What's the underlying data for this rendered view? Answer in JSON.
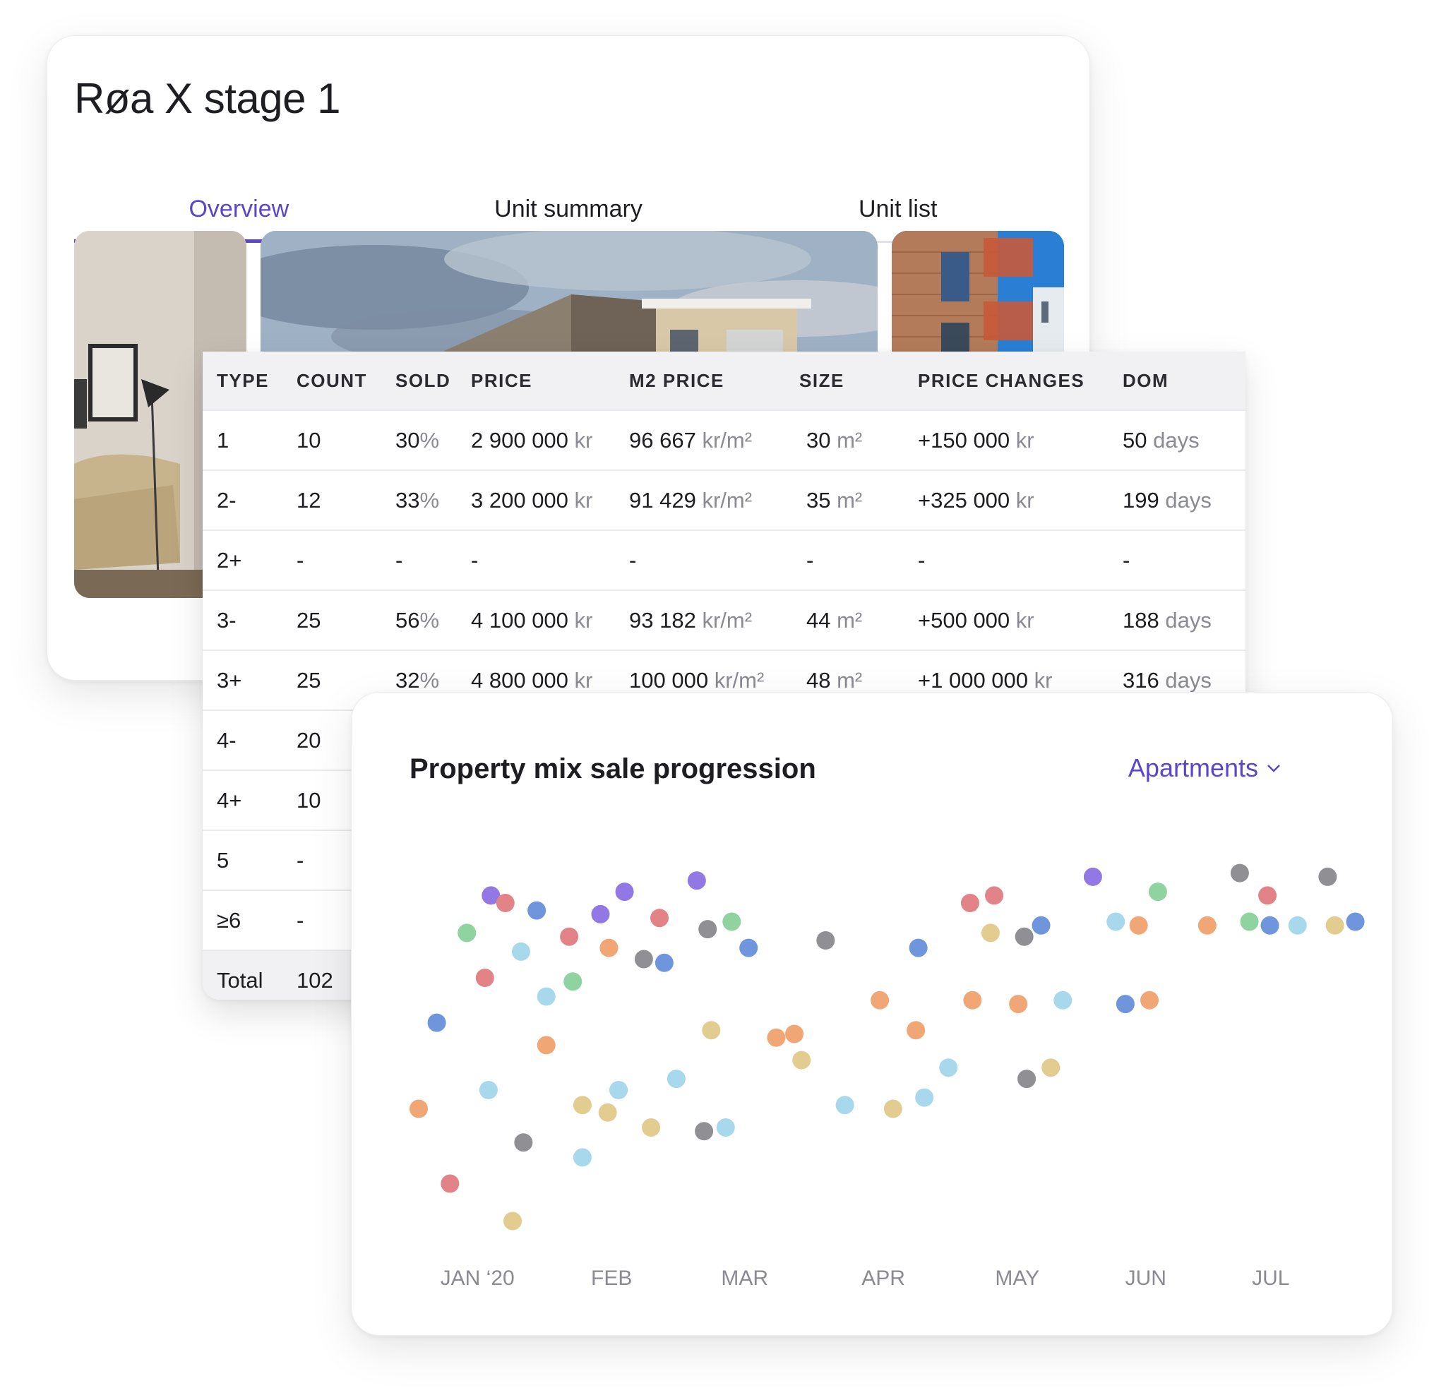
{
  "project": {
    "title": "Røa X stage 1",
    "tabs": [
      {
        "label": "Overview",
        "active": true
      },
      {
        "label": "Unit summary",
        "active": false
      },
      {
        "label": "Unit list",
        "active": false
      }
    ]
  },
  "table": {
    "headers": [
      "TYPE",
      "COUNT",
      "SOLD",
      "PRICE",
      "M2 PRICE",
      "SIZE",
      "PRICE CHANGES",
      "DOM"
    ],
    "rows": [
      {
        "type": "1",
        "count": "10",
        "sold": "30",
        "sold_unit": "%",
        "price": "2 900 000",
        "price_unit": "kr",
        "m2": "96 667",
        "m2_unit": "kr/m²",
        "size": "30",
        "size_unit": "m²",
        "change": "+150 000",
        "change_unit": "kr",
        "dom": "50",
        "dom_unit": "days"
      },
      {
        "type": "2-",
        "count": "12",
        "sold": "33",
        "sold_unit": "%",
        "price": "3 200 000",
        "price_unit": "kr",
        "m2": "91 429",
        "m2_unit": "kr/m²",
        "size": "35",
        "size_unit": "m²",
        "change": "+325 000",
        "change_unit": "kr",
        "dom": "199",
        "dom_unit": "days"
      },
      {
        "type": "2+",
        "count": "-",
        "sold": "-",
        "sold_unit": "",
        "price": "-",
        "price_unit": "",
        "m2": "-",
        "m2_unit": "",
        "size": "-",
        "size_unit": "",
        "change": "-",
        "change_unit": "",
        "dom": "-",
        "dom_unit": ""
      },
      {
        "type": "3-",
        "count": "25",
        "sold": "56",
        "sold_unit": "%",
        "price": "4 100 000",
        "price_unit": "kr",
        "m2": "93 182",
        "m2_unit": "kr/m²",
        "size": "44",
        "size_unit": "m²",
        "change": "+500 000",
        "change_unit": "kr",
        "dom": "188",
        "dom_unit": "days"
      },
      {
        "type": "3+",
        "count": "25",
        "sold": "32",
        "sold_unit": "%",
        "price": "4 800 000",
        "price_unit": "kr",
        "m2": "100 000",
        "m2_unit": "kr/m²",
        "size": "48",
        "size_unit": "m²",
        "change": "+1 000 000",
        "change_unit": "kr",
        "dom": "316",
        "dom_unit": "days"
      },
      {
        "type": "4-",
        "count": "20"
      },
      {
        "type": "4+",
        "count": "10"
      },
      {
        "type": "5",
        "count": "-"
      },
      {
        "type": "≥6",
        "count": "-"
      }
    ],
    "total": {
      "label": "Total",
      "count": "102"
    }
  },
  "chart": {
    "title": "Property mix sale progression",
    "filter": "Apartments",
    "colors": {
      "orange": "#f1a676",
      "red": "#e28387",
      "blue": "#6f95dd",
      "green": "#8fd3a0",
      "lightblue": "#a7d8ec",
      "purple": "#9278e4",
      "gray": "#8f8f94",
      "yellow": "#e3cc8f"
    }
  },
  "chart_data": {
    "type": "scatter",
    "x_ticks": [
      "JAN ‘20",
      "FEB",
      "MAR",
      "APR",
      "MAY",
      "JUN",
      "JUL"
    ],
    "x_domain": [
      0,
      7.3
    ],
    "y_domain": [
      0,
      100
    ],
    "points": [
      {
        "x": 0.0,
        "y": 35,
        "c": "orange"
      },
      {
        "x": 0.15,
        "y": 58,
        "c": "blue"
      },
      {
        "x": 0.26,
        "y": 15,
        "c": "red"
      },
      {
        "x": 0.4,
        "y": 82,
        "c": "green"
      },
      {
        "x": 0.55,
        "y": 70,
        "c": "red"
      },
      {
        "x": 0.6,
        "y": 92,
        "c": "purple"
      },
      {
        "x": 0.58,
        "y": 40,
        "c": "lightblue"
      },
      {
        "x": 0.72,
        "y": 90,
        "c": "red"
      },
      {
        "x": 0.78,
        "y": 5,
        "c": "yellow"
      },
      {
        "x": 0.85,
        "y": 77,
        "c": "lightblue"
      },
      {
        "x": 0.87,
        "y": 26,
        "c": "gray"
      },
      {
        "x": 0.98,
        "y": 88,
        "c": "blue"
      },
      {
        "x": 1.06,
        "y": 65,
        "c": "lightblue"
      },
      {
        "x": 1.06,
        "y": 52,
        "c": "orange"
      },
      {
        "x": 1.25,
        "y": 81,
        "c": "red"
      },
      {
        "x": 1.28,
        "y": 69,
        "c": "green"
      },
      {
        "x": 1.36,
        "y": 36,
        "c": "yellow"
      },
      {
        "x": 1.36,
        "y": 22,
        "c": "lightblue"
      },
      {
        "x": 1.51,
        "y": 87,
        "c": "purple"
      },
      {
        "x": 1.58,
        "y": 78,
        "c": "orange"
      },
      {
        "x": 1.57,
        "y": 34,
        "c": "yellow"
      },
      {
        "x": 1.66,
        "y": 40,
        "c": "lightblue"
      },
      {
        "x": 1.71,
        "y": 93,
        "c": "purple"
      },
      {
        "x": 1.87,
        "y": 75,
        "c": "gray"
      },
      {
        "x": 1.93,
        "y": 30,
        "c": "yellow"
      },
      {
        "x": 2.0,
        "y": 86,
        "c": "red"
      },
      {
        "x": 2.04,
        "y": 74,
        "c": "blue"
      },
      {
        "x": 2.14,
        "y": 43,
        "c": "lightblue"
      },
      {
        "x": 2.31,
        "y": 96,
        "c": "purple"
      },
      {
        "x": 2.37,
        "y": 29,
        "c": "gray"
      },
      {
        "x": 2.4,
        "y": 83,
        "c": "gray"
      },
      {
        "x": 2.43,
        "y": 56,
        "c": "yellow"
      },
      {
        "x": 2.55,
        "y": 30,
        "c": "lightblue"
      },
      {
        "x": 2.6,
        "y": 85,
        "c": "green"
      },
      {
        "x": 2.74,
        "y": 78,
        "c": "blue"
      },
      {
        "x": 2.97,
        "y": 54,
        "c": "orange"
      },
      {
        "x": 3.12,
        "y": 55,
        "c": "orange"
      },
      {
        "x": 3.18,
        "y": 48,
        "c": "yellow"
      },
      {
        "x": 3.38,
        "y": 80,
        "c": "gray"
      },
      {
        "x": 3.54,
        "y": 36,
        "c": "lightblue"
      },
      {
        "x": 3.83,
        "y": 64,
        "c": "orange"
      },
      {
        "x": 3.94,
        "y": 35,
        "c": "yellow"
      },
      {
        "x": 4.13,
        "y": 56,
        "c": "orange"
      },
      {
        "x": 4.15,
        "y": 78,
        "c": "blue"
      },
      {
        "x": 4.2,
        "y": 38,
        "c": "lightblue"
      },
      {
        "x": 4.4,
        "y": 46,
        "c": "lightblue"
      },
      {
        "x": 4.58,
        "y": 90,
        "c": "red"
      },
      {
        "x": 4.6,
        "y": 64,
        "c": "orange"
      },
      {
        "x": 4.75,
        "y": 82,
        "c": "yellow"
      },
      {
        "x": 4.78,
        "y": 92,
        "c": "red"
      },
      {
        "x": 4.98,
        "y": 63,
        "c": "orange"
      },
      {
        "x": 5.03,
        "y": 81,
        "c": "gray"
      },
      {
        "x": 5.05,
        "y": 43,
        "c": "gray"
      },
      {
        "x": 5.17,
        "y": 84,
        "c": "blue"
      },
      {
        "x": 5.25,
        "y": 46,
        "c": "yellow"
      },
      {
        "x": 5.35,
        "y": 64,
        "c": "lightblue"
      },
      {
        "x": 5.6,
        "y": 97,
        "c": "purple"
      },
      {
        "x": 5.79,
        "y": 85,
        "c": "lightblue"
      },
      {
        "x": 5.87,
        "y": 63,
        "c": "blue"
      },
      {
        "x": 5.98,
        "y": 84,
        "c": "orange"
      },
      {
        "x": 6.07,
        "y": 64,
        "c": "orange"
      },
      {
        "x": 6.14,
        "y": 93,
        "c": "green"
      },
      {
        "x": 6.55,
        "y": 84,
        "c": "orange"
      },
      {
        "x": 6.82,
        "y": 98,
        "c": "gray"
      },
      {
        "x": 6.9,
        "y": 85,
        "c": "green"
      },
      {
        "x": 7.05,
        "y": 92,
        "c": "red"
      },
      {
        "x": 7.07,
        "y": 84,
        "c": "blue"
      },
      {
        "x": 7.3,
        "y": 84,
        "c": "lightblue"
      },
      {
        "x": 7.55,
        "y": 97,
        "c": "gray"
      },
      {
        "x": 7.61,
        "y": 84,
        "c": "yellow"
      },
      {
        "x": 7.78,
        "y": 85,
        "c": "blue"
      }
    ]
  }
}
